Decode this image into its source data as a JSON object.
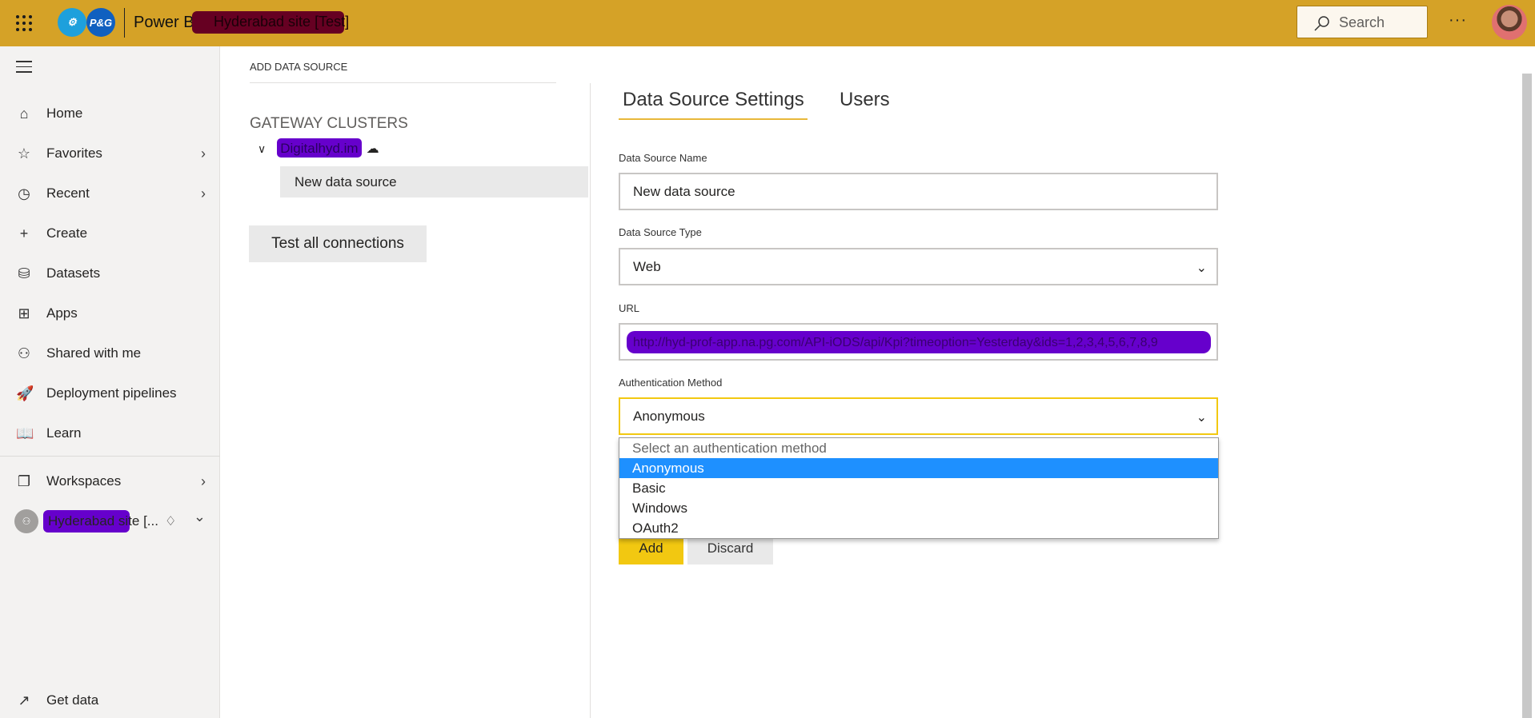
{
  "header": {
    "app_name": "Power BI",
    "workspace_title": "Hyderabad site [Test]",
    "search_placeholder": "Search",
    "more": "···",
    "logos": [
      "gear-analytics-logo",
      "pg-logo"
    ]
  },
  "sidebar": {
    "items": [
      {
        "label": "Home",
        "icon": "home-icon",
        "glyph": "⌂",
        "chevron": false
      },
      {
        "label": "Favorites",
        "icon": "star-icon",
        "glyph": "☆",
        "chevron": true
      },
      {
        "label": "Recent",
        "icon": "clock-icon",
        "glyph": "◷",
        "chevron": true
      },
      {
        "label": "Create",
        "icon": "plus-icon",
        "glyph": "+",
        "chevron": false
      },
      {
        "label": "Datasets",
        "icon": "database-icon",
        "glyph": "⛁",
        "chevron": false
      },
      {
        "label": "Apps",
        "icon": "apps-icon",
        "glyph": "⊞",
        "chevron": false
      },
      {
        "label": "Shared with me",
        "icon": "shared-icon",
        "glyph": "⚇",
        "chevron": false
      },
      {
        "label": "Deployment pipelines",
        "icon": "rocket-icon",
        "glyph": "🚀",
        "chevron": false
      },
      {
        "label": "Learn",
        "icon": "book-icon",
        "glyph": "📖",
        "chevron": false
      }
    ],
    "workspaces": "Workspaces",
    "current_workspace": "Hyderabad site [...",
    "get_data": "Get data",
    "chevron": "›",
    "chevron_down": "⌄"
  },
  "breadcrumb": "ADD DATA SOURCE",
  "left_panel": {
    "heading": "GATEWAY CLUSTERS",
    "cluster_name": "Digitalhyd.im",
    "data_source": "New data source",
    "test_button": "Test all connections"
  },
  "tabs": [
    {
      "label": "Data Source Settings",
      "active": true
    },
    {
      "label": "Users",
      "active": false
    }
  ],
  "form": {
    "name_label": "Data Source Name",
    "name_value": "New data source",
    "type_label": "Data Source Type",
    "type_value": "Web",
    "url_label": "URL",
    "url_value": "http://hyd-prof-app.na.pg.com/API-iODS/api/Kpi?timeoption=Yesterday&ids=1,2,3,4,5,6,7,8,9",
    "auth_label": "Authentication Method",
    "auth_value": "Anonymous",
    "auth_options": [
      "Select an authentication method",
      "Anonymous",
      "Basic",
      "Windows",
      "OAuth2"
    ],
    "add": "Add",
    "discard": "Discard"
  },
  "colors": {
    "header": "#d5a227",
    "accent": "#f2c811",
    "selected_option": "#1e90ff",
    "redaction": "#6600cc"
  }
}
